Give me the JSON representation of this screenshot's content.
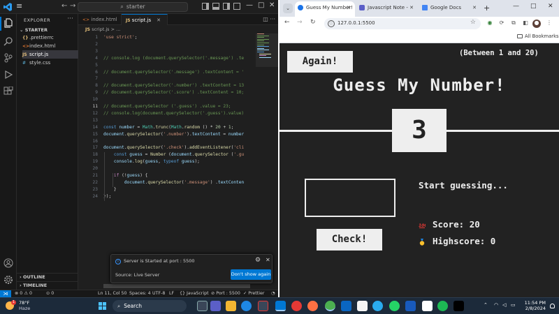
{
  "vscode": {
    "search_text": "starter",
    "explorer_title": "EXPLORER",
    "folder": "STARTER",
    "files": [
      {
        "name": ".prettierrc",
        "icon": "{}",
        "color": "#e5c07b"
      },
      {
        "name": "index.html",
        "icon": "<>",
        "color": "#e37933"
      },
      {
        "name": "script.js",
        "icon": "JS",
        "color": "#e5c07b"
      },
      {
        "name": "style.css",
        "icon": "#",
        "color": "#519aba"
      }
    ],
    "outline": "OUTLINE",
    "timeline": "TIMELINE",
    "tabs": [
      {
        "label": "index.html",
        "icon": "<>",
        "color": "#e37933"
      },
      {
        "label": "script.js",
        "icon": "JS",
        "color": "#e5c07b"
      }
    ],
    "breadcrumb": "script.js",
    "breadcrumb_sep": ">",
    "breadcrumb_tail": "...",
    "line_numbers": [
      "1",
      "2",
      "3",
      "4",
      "5",
      "6",
      "7",
      "8",
      "9",
      "10",
      "11",
      "12",
      "13",
      "14",
      "15",
      "16",
      "17",
      "18",
      "19",
      "20",
      "21",
      "22",
      "23",
      "24"
    ],
    "current_line": "11",
    "toast": {
      "message": "Server is Started at port : 5500",
      "source": "Source: Live Server",
      "button": "Don't show again"
    },
    "status": {
      "errors": "0",
      "warnings": "0",
      "ports": "0",
      "position": "Ln 11, Col 50",
      "spaces": "Spaces: 4",
      "encoding": "UTF-8",
      "eol": "LF",
      "language": "JavaScript",
      "port": "Port : 5500",
      "prettier": "Prettier"
    }
  },
  "chrome": {
    "tabs": [
      {
        "label": "Guess My Number!",
        "favicon_color": "#1a73e8"
      },
      {
        "label": "Javascript Note -",
        "favicon_color": "#5b5fc7"
      },
      {
        "label": "Google Docs",
        "favicon_color": "#4285f4"
      }
    ],
    "new_tab": "+",
    "url": "127.0.0.1:5500",
    "bookmarks": "All Bookmarks"
  },
  "game": {
    "again": "Again!",
    "range": "(Between 1 and 20)",
    "title": "Guess My Number!",
    "number": "3",
    "check": "Check!",
    "message": "Start guessing...",
    "score_label": "Score:",
    "score": "20",
    "highscore_label": "Highscore:",
    "highscore": "0"
  },
  "taskbar": {
    "weather_temp": "78°F",
    "weather_desc": "Haze",
    "weather_badge": "1",
    "search": "Search",
    "time": "11:54 PM",
    "date": "2/8/2024"
  }
}
